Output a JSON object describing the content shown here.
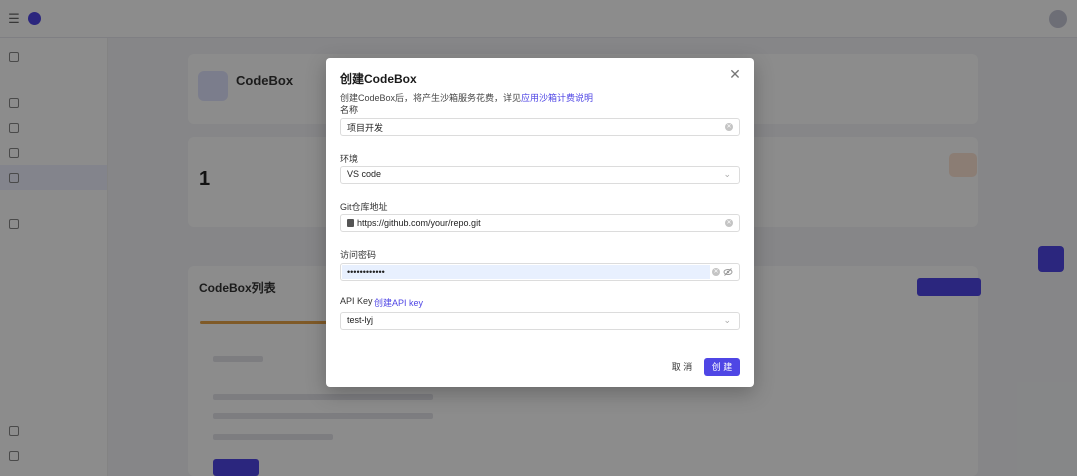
{
  "modal": {
    "title": "创建CodeBox",
    "close_icon": "close-icon",
    "desc_prefix": "创建CodeBox后，将产生沙箱服务花费，详见",
    "desc_link": "应用沙箱计费说明",
    "name_label": "名称",
    "name_value": "项目开发",
    "env_label": "环境",
    "env_value": "VS code",
    "git_label": "Git仓库地址",
    "git_value": "https://github.com/your/repo.git",
    "pwd_label": "访问密码",
    "pwd_value": "••••••••••••",
    "apikey_label": "API Key",
    "apikey_link": "创建API key",
    "apikey_value": "test-lyj",
    "cancel_label": "取 消",
    "ok_label": "创 建"
  },
  "background": {
    "hero_title": "CodeBox",
    "res_title": "CodeBox列表",
    "stat_value": "1"
  },
  "colors": {
    "accent": "#4f46e5",
    "overlay": "rgba(0,0,0,0.45)"
  }
}
